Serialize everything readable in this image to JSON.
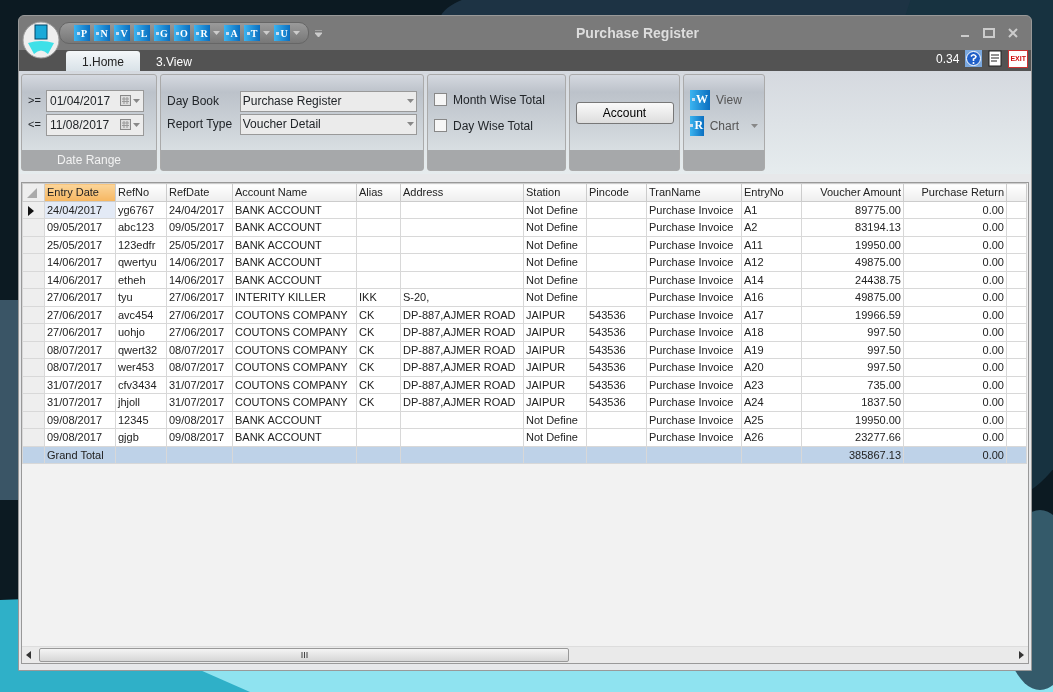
{
  "window": {
    "title": "Purchase Register"
  },
  "quick_access": [
    {
      "letter": "P",
      "dropdown": false
    },
    {
      "letter": "N",
      "dropdown": false
    },
    {
      "letter": "V",
      "dropdown": false
    },
    {
      "letter": "L",
      "dropdown": false
    },
    {
      "letter": "G",
      "dropdown": false
    },
    {
      "letter": "O",
      "dropdown": false
    },
    {
      "letter": "R",
      "dropdown": true
    },
    {
      "letter": "A",
      "dropdown": false
    },
    {
      "letter": "T",
      "dropdown": true
    },
    {
      "letter": "U",
      "dropdown": true
    }
  ],
  "tabs": [
    {
      "label": "1.Home",
      "selected": true
    },
    {
      "label": "3.View",
      "selected": false
    }
  ],
  "status_value": "0.34",
  "exit_label": "EXIT",
  "date_range": {
    "label": "Date Range",
    "from_op": ">=",
    "from": "01/04/2017",
    "to_op": "<=",
    "to": "11/08/2017"
  },
  "day_book": {
    "label": "Day Book",
    "value": "Purchase Register"
  },
  "report_type": {
    "label": "Report Type",
    "value": "Voucher Detail"
  },
  "options": [
    {
      "label": "Month Wise Total",
      "checked": false
    },
    {
      "label": "Day Wise Total",
      "checked": false
    }
  ],
  "account_button": "Account",
  "view_buttons": [
    {
      "letter": "W",
      "label": "View",
      "dropdown": false
    },
    {
      "letter": "R",
      "label": "Chart",
      "dropdown": true
    }
  ],
  "table": {
    "columns": [
      {
        "label": "Entry Date",
        "kind": "text",
        "selected": true
      },
      {
        "label": "RefNo",
        "kind": "text",
        "selected": false
      },
      {
        "label": "RefDate",
        "kind": "text",
        "selected": false
      },
      {
        "label": "Account Name",
        "kind": "text",
        "selected": false
      },
      {
        "label": "Alias",
        "kind": "text",
        "selected": false
      },
      {
        "label": "Address",
        "kind": "text",
        "selected": false
      },
      {
        "label": "Station",
        "kind": "text",
        "selected": false
      },
      {
        "label": "Pincode",
        "kind": "text",
        "selected": false
      },
      {
        "label": "TranName",
        "kind": "text",
        "selected": false
      },
      {
        "label": "EntryNo",
        "kind": "text",
        "selected": false
      },
      {
        "label": "Voucher Amount",
        "kind": "number",
        "selected": false
      },
      {
        "label": "Purchase Return",
        "kind": "number",
        "selected": false
      }
    ],
    "rows": [
      {
        "selected": true,
        "cells": [
          "24/04/2017",
          "yg6767",
          "24/04/2017",
          "BANK ACCOUNT",
          "",
          "",
          "Not Define",
          "",
          "Purchase Invoice",
          "A1",
          "89775.00",
          "0.00"
        ]
      },
      {
        "selected": false,
        "cells": [
          "09/05/2017",
          "abc123",
          "09/05/2017",
          "BANK ACCOUNT",
          "",
          "",
          "Not Define",
          "",
          "Purchase Invoice",
          "A2",
          "83194.13",
          "0.00"
        ]
      },
      {
        "selected": false,
        "cells": [
          "25/05/2017",
          "123edfr",
          "25/05/2017",
          "BANK ACCOUNT",
          "",
          "",
          "Not Define",
          "",
          "Purchase Invoice",
          "A11",
          "19950.00",
          "0.00"
        ]
      },
      {
        "selected": false,
        "cells": [
          "14/06/2017",
          "qwertyu",
          "14/06/2017",
          "BANK ACCOUNT",
          "",
          "",
          "Not Define",
          "",
          "Purchase Invoice",
          "A12",
          "49875.00",
          "0.00"
        ]
      },
      {
        "selected": false,
        "cells": [
          "14/06/2017",
          "etheh",
          "14/06/2017",
          "BANK ACCOUNT",
          "",
          "",
          "Not Define",
          "",
          "Purchase Invoice",
          "A14",
          "24438.75",
          "0.00"
        ]
      },
      {
        "selected": false,
        "cells": [
          "27/06/2017",
          "tyu",
          "27/06/2017",
          "INTERITY KILLER",
          "IKK",
          "S-20,",
          "Not Define",
          "",
          "Purchase Invoice",
          "A16",
          "49875.00",
          "0.00"
        ]
      },
      {
        "selected": false,
        "cells": [
          "27/06/2017",
          "avc454",
          "27/06/2017",
          "COUTONS COMPANY",
          "CK",
          "DP-887,AJMER ROAD",
          "JAIPUR",
          "543536",
          "Purchase Invoice",
          "A17",
          "19966.59",
          "0.00"
        ]
      },
      {
        "selected": false,
        "cells": [
          "27/06/2017",
          "uohjo",
          "27/06/2017",
          "COUTONS COMPANY",
          "CK",
          "DP-887,AJMER ROAD",
          "JAIPUR",
          "543536",
          "Purchase Invoice",
          "A18",
          "997.50",
          "0.00"
        ]
      },
      {
        "selected": false,
        "cells": [
          "08/07/2017",
          "qwert32",
          "08/07/2017",
          "COUTONS COMPANY",
          "CK",
          "DP-887,AJMER ROAD",
          "JAIPUR",
          "543536",
          "Purchase Invoice",
          "A19",
          "997.50",
          "0.00"
        ]
      },
      {
        "selected": false,
        "cells": [
          "08/07/2017",
          "wer453",
          "08/07/2017",
          "COUTONS COMPANY",
          "CK",
          "DP-887,AJMER ROAD",
          "JAIPUR",
          "543536",
          "Purchase Invoice",
          "A20",
          "997.50",
          "0.00"
        ]
      },
      {
        "selected": false,
        "cells": [
          "31/07/2017",
          "cfv3434",
          "31/07/2017",
          "COUTONS COMPANY",
          "CK",
          "DP-887,AJMER ROAD",
          "JAIPUR",
          "543536",
          "Purchase Invoice",
          "A23",
          "735.00",
          "0.00"
        ]
      },
      {
        "selected": false,
        "cells": [
          "31/07/2017",
          "jhjoll",
          "31/07/2017",
          "COUTONS COMPANY",
          "CK",
          "DP-887,AJMER ROAD",
          "JAIPUR",
          "543536",
          "Purchase Invoice",
          "A24",
          "1837.50",
          "0.00"
        ]
      },
      {
        "selected": false,
        "cells": [
          "09/08/2017",
          "12345",
          "09/08/2017",
          "BANK ACCOUNT",
          "",
          "",
          "Not Define",
          "",
          "Purchase Invoice",
          "A25",
          "19950.00",
          "0.00"
        ]
      },
      {
        "selected": false,
        "cells": [
          "09/08/2017",
          "gjgb",
          "09/08/2017",
          "BANK ACCOUNT",
          "",
          "",
          "Not Define",
          "",
          "Purchase Invoice",
          "A26",
          "23277.66",
          "0.00"
        ]
      }
    ],
    "total": {
      "cells": [
        "Grand Total",
        "",
        "",
        "",
        "",
        "",
        "",
        "",
        "",
        "",
        "385867.13",
        "0.00"
      ]
    }
  }
}
